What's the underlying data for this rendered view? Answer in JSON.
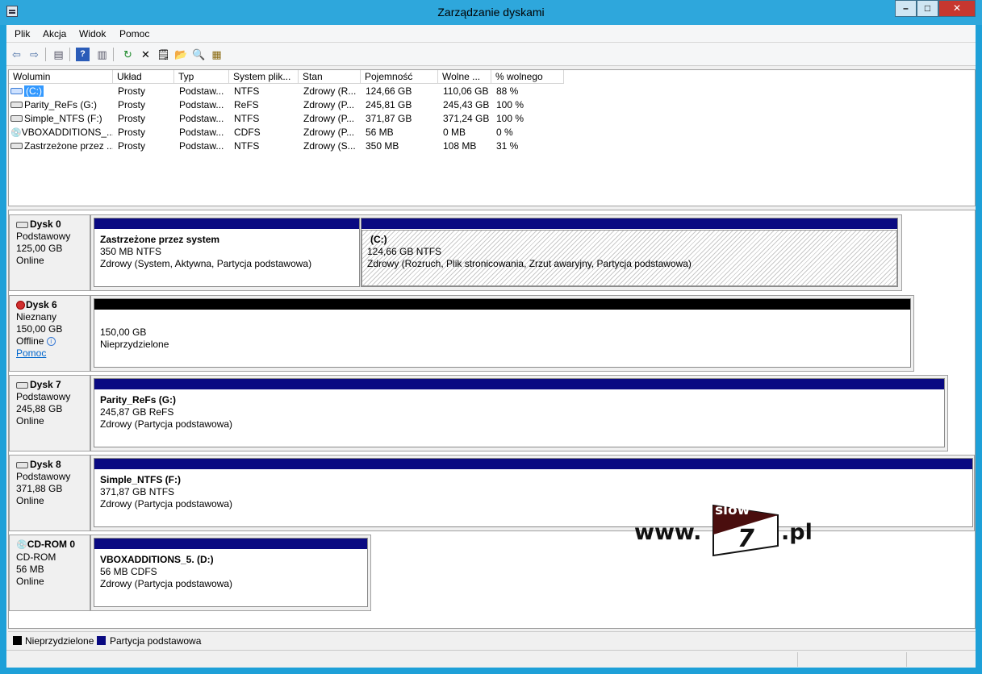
{
  "window": {
    "title": "Zarządzanie dyskami",
    "buttons": {
      "minimize": "–",
      "maximize": "□",
      "close": "✕"
    }
  },
  "menu": [
    "Plik",
    "Akcja",
    "Widok",
    "Pomoc"
  ],
  "toolbar_icons": [
    "back-icon",
    "forward-icon",
    "console-tree-icon",
    "help-icon",
    "show-hide-icon",
    "refresh-icon",
    "delete-icon",
    "properties-icon",
    "open-icon",
    "explore-icon",
    "rescan-icon"
  ],
  "volume_list": {
    "columns": [
      "Wolumin",
      "Układ",
      "Typ",
      "System plik...",
      "Stan",
      "Pojemność",
      "Wolne ...",
      "% wolnego"
    ],
    "rows": [
      [
        "(C:)",
        "Prosty",
        "Podstaw...",
        "NTFS",
        "Zdrowy (R...",
        "124,66 GB",
        "110,06 GB",
        "88 %"
      ],
      [
        "Parity_ReFs (G:)",
        "Prosty",
        "Podstaw...",
        "ReFS",
        "Zdrowy (P...",
        "245,81 GB",
        "245,43 GB",
        "100 %"
      ],
      [
        "Simple_NTFS (F:)",
        "Prosty",
        "Podstaw...",
        "NTFS",
        "Zdrowy (P...",
        "371,87 GB",
        "371,24 GB",
        "100 %"
      ],
      [
        "VBOXADDITIONS_...",
        "Prosty",
        "Podstaw...",
        "CDFS",
        "Zdrowy (P...",
        "56 MB",
        "0 MB",
        "0 %"
      ],
      [
        "Zastrzeżone przez ...",
        "Prosty",
        "Podstaw...",
        "NTFS",
        "Zdrowy (S...",
        "350 MB",
        "108 MB",
        "31 %"
      ]
    ]
  },
  "disks": [
    {
      "name": "Dysk 0",
      "type": "Podstawowy",
      "size": "125,00 GB",
      "status": "Online",
      "partitions": [
        {
          "name": "Zastrzeżone przez system",
          "size": "350 MB NTFS",
          "status": "Zdrowy (System, Aktywna, Partycja podstawowa)"
        },
        {
          "name": "(C:)",
          "size": "124,66 GB NTFS",
          "status": "Zdrowy (Rozruch, Plik stronicowania, Zrzut awaryjny, Partycja podstawowa)"
        }
      ]
    },
    {
      "name": "Dysk 6",
      "type": "Nieznany",
      "size": "150,00 GB",
      "status": "Offline",
      "help_link": "Pomoc",
      "partitions": [
        {
          "name": "",
          "size": "150,00 GB",
          "status": "Nieprzydzielone"
        }
      ]
    },
    {
      "name": "Dysk 7",
      "type": "Podstawowy",
      "size": "245,88 GB",
      "status": "Online",
      "partitions": [
        {
          "name": "Parity_ReFs  (G:)",
          "size": "245,87 GB ReFS",
          "status": "Zdrowy (Partycja podstawowa)"
        }
      ]
    },
    {
      "name": "Dysk 8",
      "type": "Podstawowy",
      "size": "371,88 GB",
      "status": "Online",
      "partitions": [
        {
          "name": "Simple_NTFS  (F:)",
          "size": "371,87 GB NTFS",
          "status": "Zdrowy (Partycja podstawowa)"
        }
      ]
    },
    {
      "name": "CD-ROM 0",
      "type": "CD-ROM",
      "size": "56 MB",
      "status": "Online",
      "partitions": [
        {
          "name": "VBOXADDITIONS_5.  (D:)",
          "size": "56 MB CDFS",
          "status": "Zdrowy (Partycja podstawowa)"
        }
      ]
    }
  ],
  "legend": [
    {
      "label": "Nieprzydzielone",
      "color": "#000000"
    },
    {
      "label": "Partycja podstawowa",
      "color": "#0a0a82"
    }
  ],
  "watermark": {
    "prefix": "www.",
    "logo_top": "slow",
    "logo_num": "7",
    "suffix": ".pl"
  }
}
